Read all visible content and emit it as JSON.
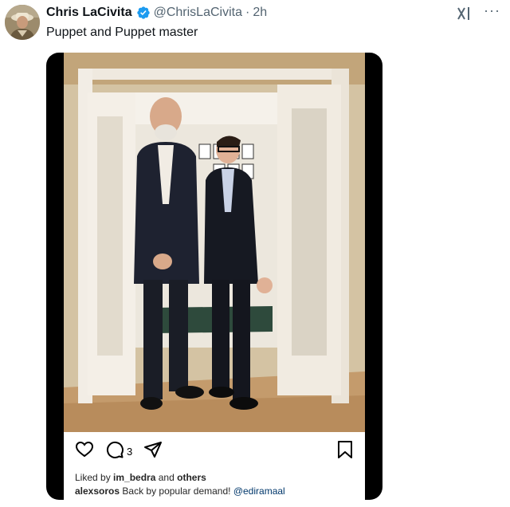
{
  "tweet": {
    "author_name": "Chris LaCivita",
    "handle": "@ChrisLaCivita",
    "separator": "·",
    "time": "2h",
    "text": "Puppet and Puppet master",
    "more_label": "···"
  },
  "instagram_post": {
    "comment_count": "3",
    "liked_by_prefix": "Liked by",
    "liked_by_user": "im_bedra",
    "liked_by_and": "and",
    "liked_by_others": "others",
    "caption_user": "alexsoros",
    "caption_text": "Back by popular demand!",
    "caption_mention": "@ediramaal"
  },
  "colors": {
    "verified": "#1d9bf0",
    "secondary_text": "#536471",
    "mention": "#00376b"
  }
}
